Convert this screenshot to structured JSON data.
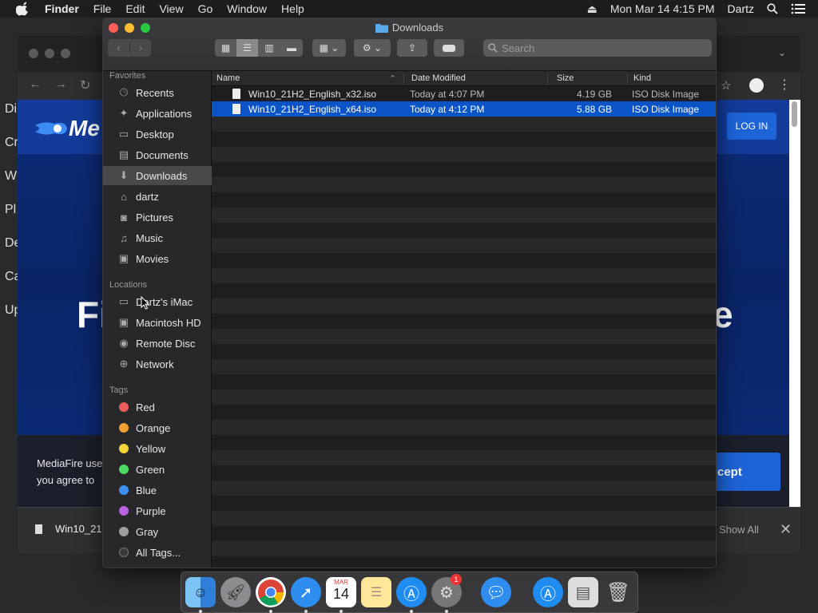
{
  "menubar": {
    "app": "Finder",
    "items": [
      "File",
      "Edit",
      "View",
      "Go",
      "Window",
      "Help"
    ],
    "datetime": "Mon Mar 14  4:15 PM",
    "user": "Dartz"
  },
  "browser": {
    "logo_text": "Me",
    "login": "LOG IN",
    "accept": "cept",
    "cookie_line1": "MediaFire use",
    "cookie_line2": "you agree to",
    "hero_left": "Fi",
    "hero_right": "e",
    "download_item": "Win10_21",
    "show_all": "Show All",
    "close": "✕",
    "left_letters": [
      "Di",
      "Cr",
      "W",
      "Pl",
      "De",
      "Ca",
      "Up"
    ]
  },
  "finder": {
    "title": "Downloads",
    "search_placeholder": "Search",
    "sidebar": {
      "favorites_header": "Favorites",
      "favorites": [
        {
          "label": "Recents",
          "icon": "clock-icon"
        },
        {
          "label": "Applications",
          "icon": "applications-icon"
        },
        {
          "label": "Desktop",
          "icon": "desktop-icon"
        },
        {
          "label": "Documents",
          "icon": "documents-icon"
        },
        {
          "label": "Downloads",
          "icon": "downloads-icon"
        },
        {
          "label": "dartz",
          "icon": "home-icon"
        },
        {
          "label": "Pictures",
          "icon": "camera-icon"
        },
        {
          "label": "Music",
          "icon": "music-icon"
        },
        {
          "label": "Movies",
          "icon": "film-icon"
        }
      ],
      "locations_header": "Locations",
      "locations": [
        {
          "label": "Dartz's iMac",
          "icon": "imac-icon"
        },
        {
          "label": "Macintosh HD",
          "icon": "disk-icon"
        },
        {
          "label": "Remote Disc",
          "icon": "disc-icon"
        },
        {
          "label": "Network",
          "icon": "globe-icon"
        }
      ],
      "tags_header": "Tags",
      "tags": [
        {
          "label": "Red",
          "color": "#ec5b5b"
        },
        {
          "label": "Orange",
          "color": "#f0a030"
        },
        {
          "label": "Yellow",
          "color": "#f2d43a"
        },
        {
          "label": "Green",
          "color": "#4cd964"
        },
        {
          "label": "Blue",
          "color": "#3a8fef"
        },
        {
          "label": "Purple",
          "color": "#bd62e0"
        },
        {
          "label": "Gray",
          "color": "#9e9e9e"
        },
        {
          "label": "All Tags...",
          "color": "#3a3a3a"
        }
      ]
    },
    "columns": {
      "name": "Name",
      "date": "Date Modified",
      "size": "Size",
      "kind": "Kind"
    },
    "files": [
      {
        "name": "Win10_21H2_English_x32.iso",
        "date": "Today at 4:07 PM",
        "size": "4.19 GB",
        "kind": "ISO Disk Image",
        "selected": false
      },
      {
        "name": "Win10_21H2_English_x64.iso",
        "date": "Today at 4:12 PM",
        "size": "5.88 GB",
        "kind": "ISO Disk Image",
        "selected": true
      }
    ]
  },
  "dock": {
    "calendar_month": "MAR",
    "calendar_day": "14",
    "badge": "1"
  }
}
